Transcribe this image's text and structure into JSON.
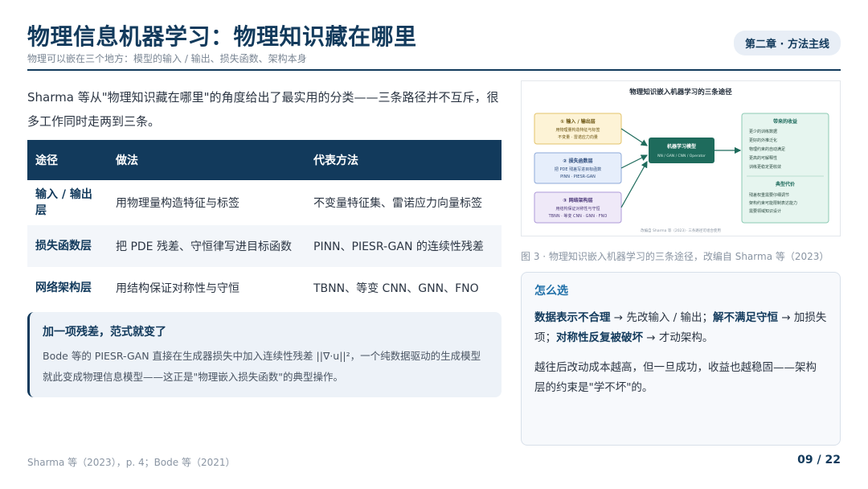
{
  "header": {
    "title": "物理信息机器学习：物理知识藏在哪里",
    "subtitle": "物理可以嵌在三个地方：模型的输入 / 输出、损失函数、架构本身",
    "chapter": "第二章 · 方法主线"
  },
  "intro": "Sharma 等从\"物理知识藏在哪里\"的角度给出了最实用的分类——三条路径并不互斥，很多工作同时走两到三条。",
  "table": {
    "headers": [
      "途径",
      "做法",
      "代表方法"
    ],
    "rows": [
      {
        "path": "输入 / 输出层",
        "method": "用物理量构造特征与标签",
        "examples": "不变量特征集、雷诺应力向量标签"
      },
      {
        "path": "损失函数层",
        "method": "把 PDE 残差、守恒律写进目标函数",
        "examples": "PINN、PIESR-GAN 的连续性残差"
      },
      {
        "path": "网络架构层",
        "method": "用结构保证对称性与守恒",
        "examples": "TBNN、等变 CNN、GNN、FNO"
      }
    ]
  },
  "callout": {
    "title": "加一项残差，范式就变了",
    "text": "Bode 等的 PIESR-GAN 直接在生成器损失中加入连续性残差 ||∇·u||²，一个纯数据驱动的生成模型就此变成物理信息模型——这正是\"物理嵌入损失函数\"的典型操作。"
  },
  "diagram": {
    "title": "物理知识嵌入机器学习的三条途径",
    "box1": {
      "title": "① 输入 / 输出层",
      "l1": "用物理量构造特征与标签",
      "l2": "不变量 · 雷诺应力向量"
    },
    "box2": {
      "title": "② 损失函数层",
      "l1": "把 PDE 残差写进目标函数",
      "l2": "PINN · PIESR-GAN"
    },
    "box3": {
      "title": "③ 网络架构层",
      "l1": "用结构保证对称性与守恒",
      "l2": "TBNN · 等变 CNN · GNN · FNO"
    },
    "center": {
      "title": "机器学习模型",
      "sub": "NN / GAN / CNN / Operator"
    },
    "right_top": {
      "title": "带来的收益",
      "items": [
        "更少的训练数据",
        "更好的外推泛化",
        "物理约束的自动满足",
        "更高的可解释性",
        "训练更稳定更收敛"
      ]
    },
    "right_bottom": {
      "title": "典型代价",
      "l1": "残差权重需要仔细调节",
      "l2": "架构约束可能限制表达能力",
      "l3": "需要领域知识设计"
    },
    "note": "改编自 Sharma 等（2023）· 三条路径可组合使用"
  },
  "caption": "图 3 · 物理知识嵌入机器学习的三条途径，改编自 Sharma 等（2023）",
  "choose": {
    "title": "怎么选",
    "p1": {
      "b1": "数据表示不合理",
      "t1": " → 先改输入 / 输出；",
      "b2": "解不满足守恒",
      "t2": " → 加损失项；",
      "b3": "对称性反复被破坏",
      "t3": " → 才动架构。"
    },
    "p2": "越往后改动成本越高，但一旦成功，收益也越稳固——架构层的约束是\"学不坏\"的。"
  },
  "footer": {
    "source": "Sharma 等（2023），p. 4；Bode 等（2021）",
    "page": "09 / 22"
  },
  "colors": {
    "primary": "#123a5c",
    "box1_fill": "#fdf3d6",
    "box1_stroke": "#e3c36a",
    "box2_fill": "#e6eefb",
    "box2_stroke": "#8ea9d8",
    "box3_fill": "#efe9f8",
    "box3_stroke": "#ae9ad8",
    "center_fill": "#1e6b5c",
    "right_fill": "#e6f5ef",
    "right_stroke": "#8ccab3"
  }
}
